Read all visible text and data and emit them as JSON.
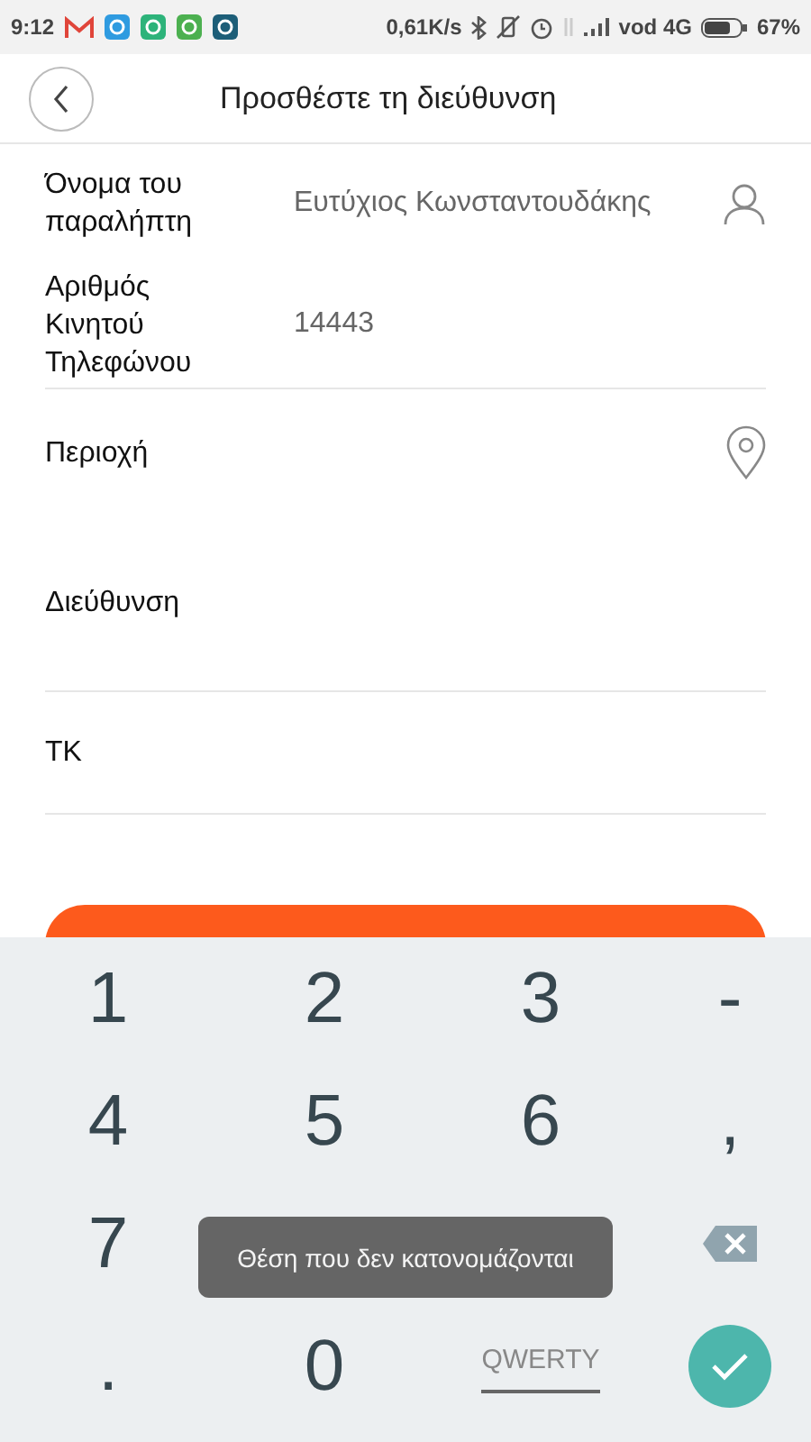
{
  "status_bar": {
    "time": "9:12",
    "speed": "0,61K/s",
    "carrier": "vod 4G",
    "battery": "67%"
  },
  "header": {
    "title": "Προσθέστε τη διεύθυνση"
  },
  "form": {
    "fields": [
      {
        "label": "Όνομα του παραλήπτη",
        "value": "Ευτύχιος Κωνσταντουδάκης"
      },
      {
        "label": "Αριθμός Κινητού Τηλεφώνου",
        "value": "14443"
      },
      {
        "label": "Περιοχή"
      },
      {
        "label": "Διεύθυνση"
      },
      {
        "label": "ΤΚ"
      }
    ]
  },
  "keyboard": {
    "keys": [
      {
        "kind": "char",
        "label": "1"
      },
      {
        "kind": "char",
        "label": "2"
      },
      {
        "kind": "char",
        "label": "3"
      },
      {
        "kind": "char",
        "label": "-"
      },
      {
        "kind": "char",
        "label": "4"
      },
      {
        "kind": "char",
        "label": "5"
      },
      {
        "kind": "char",
        "label": "6"
      },
      {
        "kind": "char",
        "label": ","
      },
      {
        "kind": "char",
        "label": "7"
      },
      {
        "kind": "covered"
      },
      {
        "kind": "covered"
      },
      {
        "kind": "backspace"
      },
      {
        "kind": "char",
        "label": "."
      },
      {
        "kind": "char",
        "label": "0"
      },
      {
        "kind": "mode",
        "label": "QWERTY"
      },
      {
        "kind": "done"
      }
    ]
  },
  "toast": "Θέση που δεν κατονομάζονται"
}
